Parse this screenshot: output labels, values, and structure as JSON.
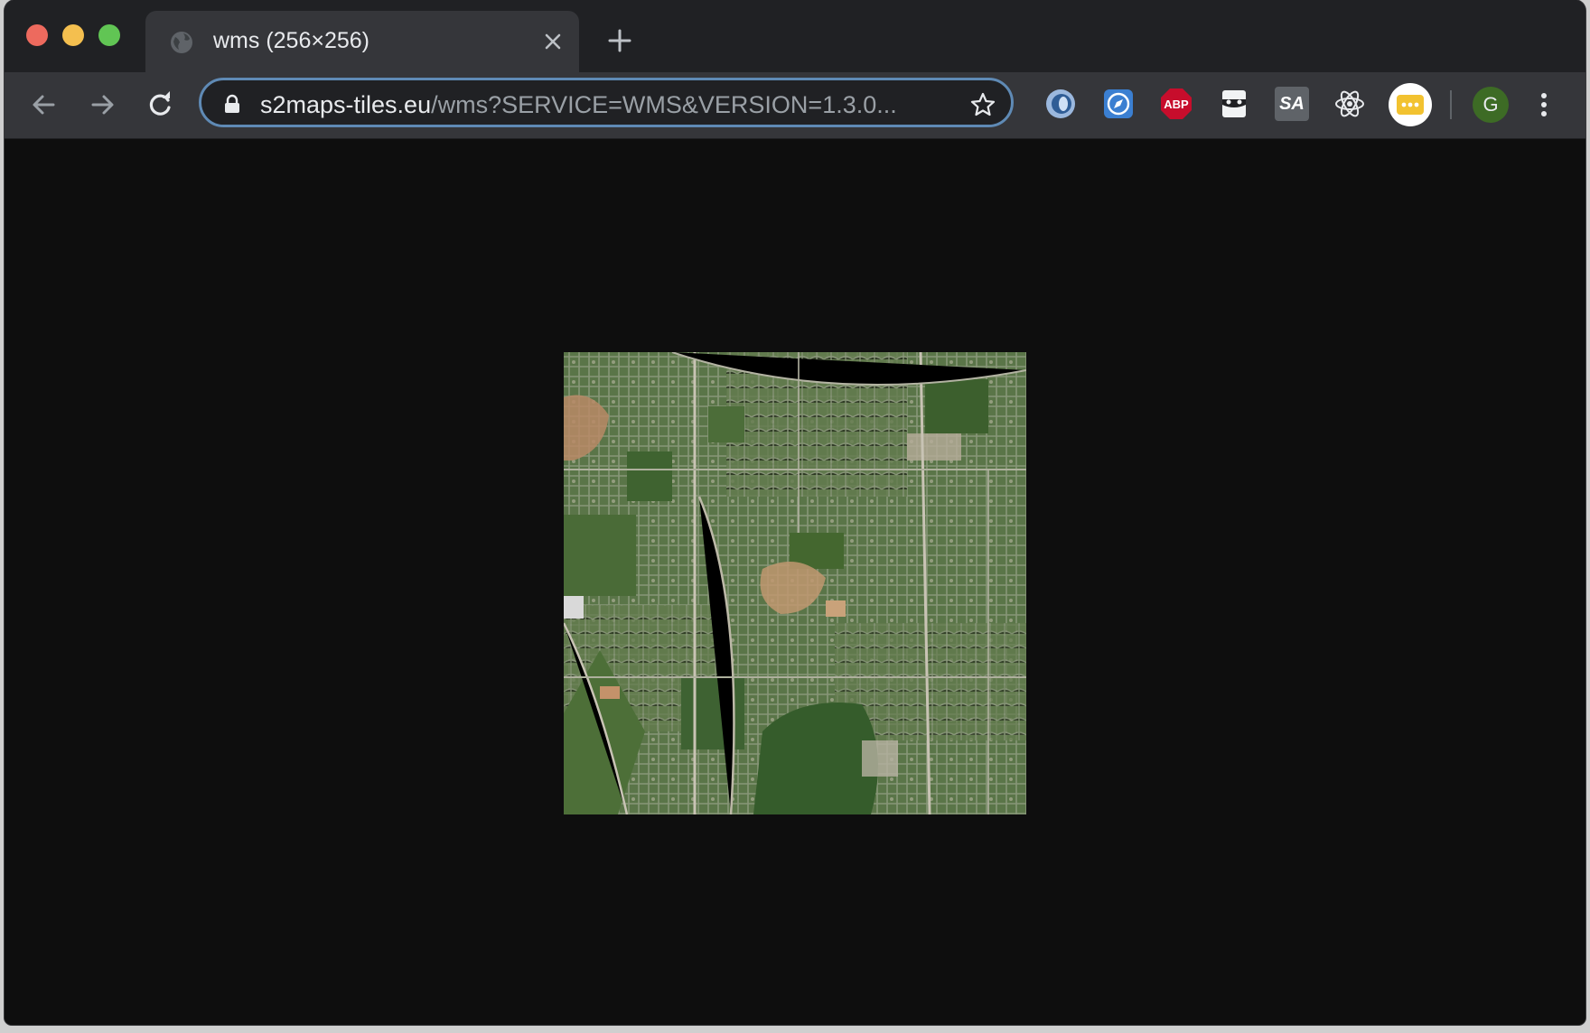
{
  "tab": {
    "title": "wms (256×256)",
    "favicon": "globe-icon"
  },
  "toolbar": {
    "url_host": "s2maps-tiles.eu",
    "url_rest": "/wms?SERVICE=WMS&VERSION=1.3.0...",
    "extensions": [
      {
        "name": "ext-blue-circle-icon",
        "label": ""
      },
      {
        "name": "ext-compass-icon",
        "label": ""
      },
      {
        "name": "ext-adblock-icon",
        "label": "ABP"
      },
      {
        "name": "ext-mask-icon",
        "label": ""
      },
      {
        "name": "ext-sa-icon",
        "label": "SA"
      },
      {
        "name": "ext-react-icon",
        "label": ""
      },
      {
        "name": "ext-dots-icon",
        "label": ""
      }
    ],
    "avatar_initial": "G"
  },
  "content": {
    "image": "satellite-tile",
    "image_pixel_size": "256×256"
  },
  "colors": {
    "accent": "#5f8ab5",
    "page_background": "#0e0e0e",
    "abp_red": "#c70d2c",
    "avatar_green": "#3d6b25"
  }
}
